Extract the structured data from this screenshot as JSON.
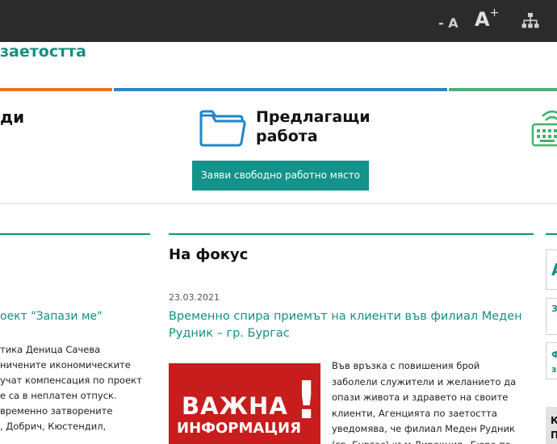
{
  "toolbar": {
    "font_decrease_label": "- A",
    "font_increase_label": "A",
    "font_increase_sup": "+",
    "sitemap_icon": "sitemap-icon"
  },
  "header": {
    "agency_title": "заетостта"
  },
  "categories": {
    "left_label": "ди",
    "offer_title_line1": "Предлагащи",
    "offer_title_line2": "работа",
    "offer_icon": "folder-icon",
    "right_icon": "keyboard-icon",
    "offer_button_label": "Заяви свободно работно място"
  },
  "left_column": {
    "news_title": "оект \"Запази ме\"",
    "news_lines": [
      "тика Деница Сачева",
      "ничените икономическите",
      "учат компенсация по проект",
      "е са в неплатен отпуск.",
      "временно затворените",
      ", Добрич, Кюстендил,"
    ]
  },
  "focus": {
    "heading": "На фокус",
    "date": "23.03.2021",
    "title": "Временно спира приемът на клиенти във филиал Меден Рудник – гр. Бургас",
    "image_word1": "ВАЖНА",
    "image_word2": "ИНФОРМАЦИЯ",
    "image_mark": "!",
    "body_lines": [
      "Във връзка с повишения брой",
      "заболели служители и желанието да",
      "опази живота и здравето на своите",
      "клиенти, Агенцията по заетостта",
      "уведомява, че филиал Меден Рудник",
      "(гр. Бургас) към Дирекция „Бюро по"
    ]
  },
  "right_column": {
    "box1_text": "А",
    "box2_text": "З",
    "box3_line1": "Ф",
    "box3_line2": "з",
    "box4_line1": "К",
    "box4_line2": "П"
  },
  "colors": {
    "accent": "#138f7e",
    "button": "#13938a",
    "topbar": "#2b2b2b",
    "strip_orange": "#e8742c",
    "strip_blue": "#2a86c4",
    "strip_green": "#4cb07e",
    "image_red": "#c81d1d"
  }
}
